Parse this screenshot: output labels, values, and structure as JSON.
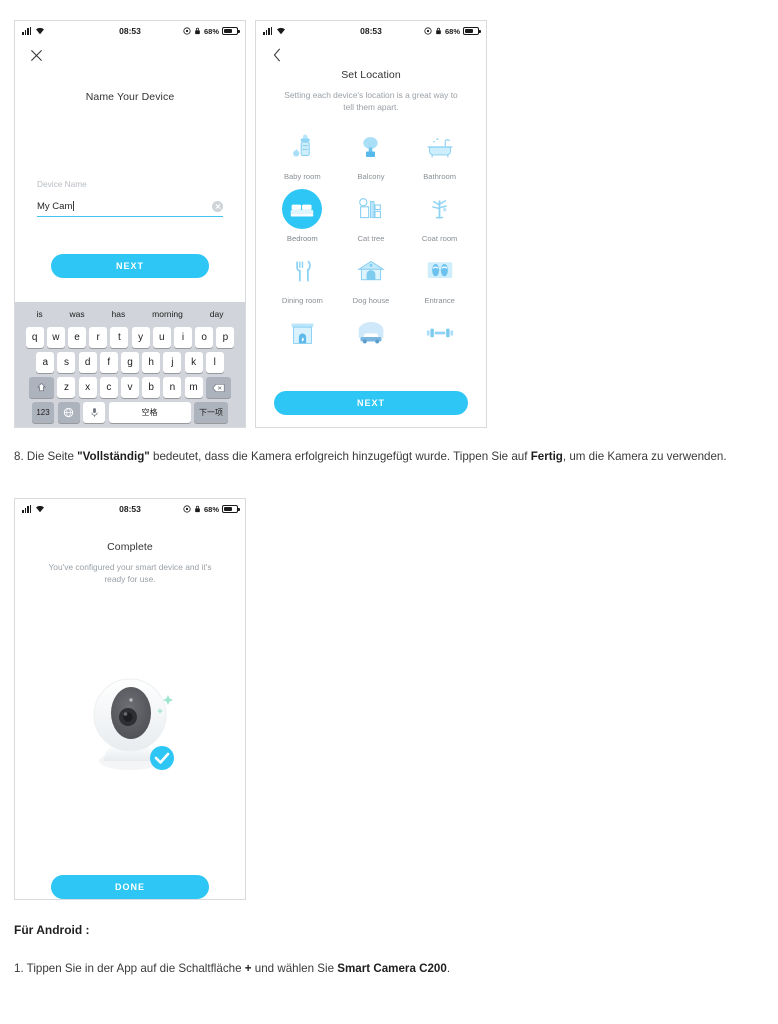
{
  "status_bar": {
    "time": "08:53",
    "battery_text": "68%",
    "signal_icon": "signal-bars-icon",
    "wifi_icon": "wifi-icon",
    "alarm_icon": "alarm-icon",
    "lock_icon": "lock-icon",
    "battery_icon": "battery-icon"
  },
  "colors": {
    "accent": "#2ec6f4",
    "muted_text": "#9aa0a6",
    "keyboard_bg": "#d1d4da"
  },
  "screen_name_device": {
    "close_icon": "close-icon",
    "title": "Name Your Device",
    "field_label": "Device Name",
    "field_value": "My Cam",
    "clear_icon": "clear-circle-icon",
    "next_label": "NEXT"
  },
  "keyboard": {
    "suggestions": [
      "is",
      "was",
      "has",
      "morning",
      "day"
    ],
    "row1": [
      "q",
      "w",
      "e",
      "r",
      "t",
      "y",
      "u",
      "i",
      "o",
      "p"
    ],
    "row2": [
      "a",
      "s",
      "d",
      "f",
      "g",
      "h",
      "j",
      "k",
      "l"
    ],
    "row3": [
      "z",
      "x",
      "c",
      "v",
      "b",
      "n",
      "m"
    ],
    "shift_icon": "shift-icon",
    "backspace_icon": "backspace-icon",
    "numbers_key": "123",
    "globe_icon": "globe-icon",
    "mic_icon": "microphone-icon",
    "space_key": "空格",
    "next_key": "下一项"
  },
  "screen_set_location": {
    "back_icon": "back-chevron-icon",
    "title": "Set Location",
    "subtitle": "Setting each device's location is a great way to tell them apart.",
    "next_label": "NEXT",
    "locations": [
      {
        "label": "Baby room",
        "icon": "baby-bottle-icon",
        "selected": false
      },
      {
        "label": "Balcony",
        "icon": "tree-icon",
        "selected": false
      },
      {
        "label": "Bathroom",
        "icon": "bathtub-icon",
        "selected": false
      },
      {
        "label": "Bedroom",
        "icon": "bed-icon",
        "selected": true
      },
      {
        "label": "Cat tree",
        "icon": "cat-tree-icon",
        "selected": false
      },
      {
        "label": "Coat room",
        "icon": "coat-rack-icon",
        "selected": false
      },
      {
        "label": "Dining room",
        "icon": "cutlery-icon",
        "selected": false
      },
      {
        "label": "Dog house",
        "icon": "dog-house-icon",
        "selected": false
      },
      {
        "label": "Entrance",
        "icon": "slippers-icon",
        "selected": false
      },
      {
        "label": "",
        "icon": "fireplace-icon",
        "selected": false
      },
      {
        "label": "",
        "icon": "garage-car-icon",
        "selected": false
      },
      {
        "label": "",
        "icon": "dumbbell-icon",
        "selected": false
      }
    ]
  },
  "screen_complete": {
    "title": "Complete",
    "subtitle": "You've configured your smart device and it's ready for use.",
    "camera_icon": "smart-camera-illustration",
    "success_icon": "check-badge-icon",
    "done_label": "DONE"
  },
  "document": {
    "step_8_prefix": "8. Die Seite ",
    "step_8_bold1": "\"Vollständig\"",
    "step_8_mid": " bedeutet, dass die Kamera erfolgreich hinzugefügt wurde. Tippen Sie auf ",
    "step_8_bold2": "Fertig",
    "step_8_suffix": ", um die Kamera zu verwenden.",
    "android_heading": "Für Android :",
    "step_1_prefix": "1. Tippen Sie in der App auf die Schaltfläche ",
    "step_1_bold1": "+",
    "step_1_mid": " und wählen Sie ",
    "step_1_bold2": "Smart Camera C200",
    "step_1_suffix": "."
  }
}
